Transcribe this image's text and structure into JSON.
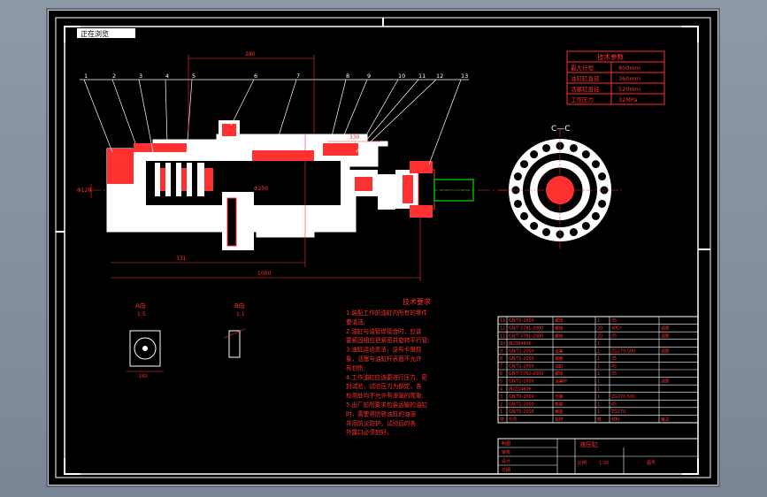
{
  "window": {
    "tab_label": "正在浏览"
  },
  "balloons": [
    "1",
    "2",
    "3",
    "4",
    "5",
    "6",
    "7",
    "8",
    "9",
    "10",
    "11",
    "12",
    "13"
  ],
  "section_label": "C—C",
  "dims": {
    "top_length": "280",
    "left_length": "331",
    "bottom_length": "1000",
    "mid_length": "330",
    "left_dia": "Φ120",
    "bore": "Φ250"
  },
  "tech_params": {
    "title": "技术参数",
    "rows": [
      {
        "name": "最大行程",
        "value": "800mm"
      },
      {
        "name": "油缸缸直径",
        "value": "360mm"
      },
      {
        "name": "活塞缸直径",
        "value": "520mm"
      },
      {
        "name": "工作压力",
        "value": "32MPa"
      }
    ]
  },
  "views": {
    "a_title": "A向",
    "a_scale": "1:5",
    "a_dim": "160",
    "b_title": "B向",
    "b_scale": "1:1"
  },
  "requirements": {
    "title": "技术要求",
    "lines": [
      "1.装配工作前油缸内所有的零件",
      "  要清洁;",
      "2.油缸与油管焊接合时，应该",
      "  要紧固相应把紧密并旋转平行管;",
      "3.油缸运动灵活，没有卡阻现",
      "  象，活塞与油缸杆表面不允许",
      "  有划伤;",
      "4.工作油缸应该要进行压力、密",
      "  封试验，试验压力为额定，各",
      "  检测处均不允许有渗漏的现象;",
      "5.出厂前所要求包装运输的油缸",
      "  时，需要将防锈油缸的油液",
      "  并用防尘防护，试验后的各",
      "  外露口必须封好。"
    ]
  },
  "bom": {
    "rows": [
      [
        "13",
        "GB/T1-2000",
        "螺母",
        "1",
        "35",
        ""
      ],
      [
        "12",
        "GB/T 5781-2000",
        "螺栓",
        "20",
        "40Cr",
        "调质"
      ],
      [
        "11",
        "GB/T 5781-2000",
        "螺栓",
        "20",
        "35",
        "调质"
      ],
      [
        "10",
        "JB/ZQ4606",
        "",
        "1",
        "",
        "",
        ""
      ],
      [
        "9",
        "GB/T1-2000",
        "活塞",
        "1",
        "ZG270-500",
        "调质"
      ],
      [
        "8",
        "GB/T1-2000",
        "钢圈",
        "1",
        "35",
        ""
      ],
      [
        "7",
        "GB/T1-2000",
        "油缸",
        "1",
        "45",
        ""
      ],
      [
        "6",
        "GB/T 5782-2000",
        "螺母",
        "1",
        "35",
        ""
      ],
      [
        "5",
        "GB/T1-2000",
        "活塞杆",
        "1",
        "",
        "调质"
      ],
      [
        "4",
        "JB/ZQ4606",
        "",
        "1",
        "",
        ""
      ],
      [
        "3",
        "GB/T1-2000",
        "活塞",
        "1",
        "ZG270-500",
        ""
      ],
      [
        "2",
        "GB/T1-2000",
        "垫圈",
        "1",
        "45",
        ""
      ],
      [
        "1",
        "GB/T1-2000",
        "端盖",
        "1",
        "ZG270",
        ""
      ]
    ],
    "header": [
      "序",
      "代号",
      "名称",
      "数",
      "材料",
      "备注"
    ]
  },
  "title_block": {
    "name": "液压缸",
    "scale_label": "比例",
    "scale": "1:20",
    "sheet": "图号",
    "company": "设计",
    "check": "审核",
    "drawn": "制图",
    "date": "日期"
  }
}
